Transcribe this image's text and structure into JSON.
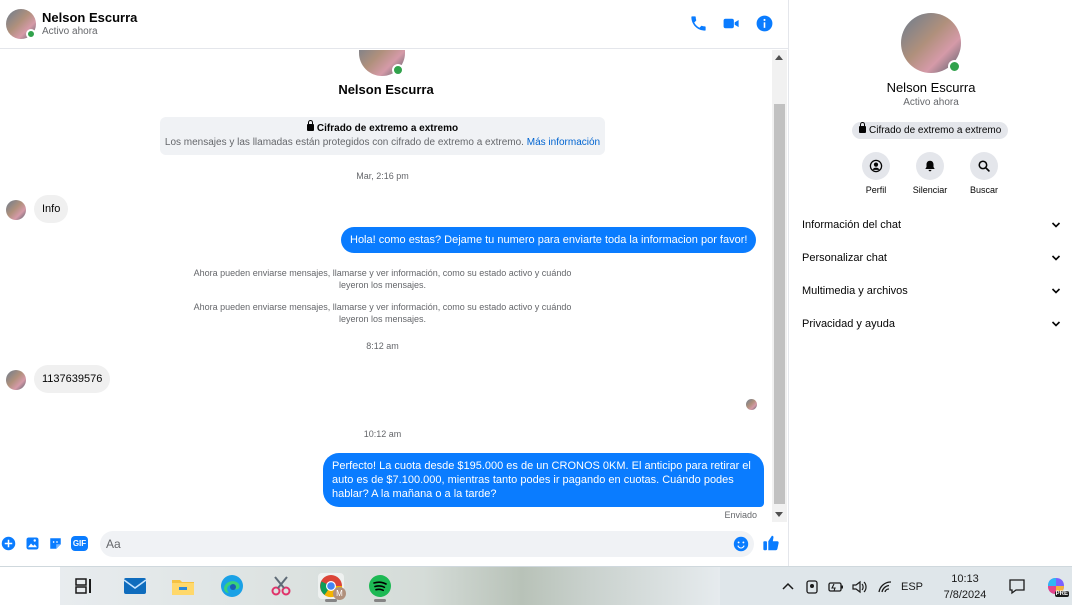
{
  "header": {
    "name": "Nelson Escurra",
    "status": "Activo ahora",
    "icons": [
      "phone-icon",
      "video-camera-icon",
      "info-icon"
    ],
    "accent_color": "#0a7cff"
  },
  "thread": {
    "contact_name": "Nelson Escurra",
    "e2e_title": "Cifrado de extremo a extremo",
    "e2e_sub": "Los mensajes y las llamadas están protegidos con cifrado de extremo a extremo.",
    "e2e_link": "Más información",
    "timestamps": [
      "Mar, 2:16 pm",
      "8:12 am",
      "10:12 am"
    ],
    "system_messages": [
      "Ahora pueden enviarse mensajes, llamarse y ver información, como su estado activo y cuándo leyeron los mensajes.",
      "Ahora pueden enviarse mensajes, llamarse y ver información, como su estado activo y cuándo leyeron los mensajes."
    ],
    "messages": [
      {
        "from": "contact",
        "text": "Info"
      },
      {
        "from": "me",
        "text": "Hola! como estas? Dejame tu numero para enviarte toda la informacion por favor!"
      },
      {
        "from": "contact",
        "text": "1137639576"
      },
      {
        "from": "me",
        "text": "Perfecto! La cuota desde $195.000 es de un CRONOS 0KM. El anticipo para retirar el auto es de $7.100.000, mientras tanto podes ir pagando en cuotas. Cuándo podes hablar? A la mañana o a la tarde?"
      }
    ],
    "sent_status": "Enviado"
  },
  "composer": {
    "placeholder": "Aa",
    "icons": [
      "plus-icon",
      "image-icon",
      "sticker-icon",
      "gif-icon",
      "emoji-icon",
      "thumbs-up-icon"
    ],
    "gif_label": "GIF"
  },
  "side_panel": {
    "name": "Nelson Escurra",
    "status": "Activo ahora",
    "e2e_badge": "Cifrado de extremo a extremo",
    "actions": [
      {
        "label": "Perfil",
        "icon": "profile-icon"
      },
      {
        "label": "Silenciar",
        "icon": "bell-icon"
      },
      {
        "label": "Buscar",
        "icon": "search-icon"
      }
    ],
    "menu": [
      {
        "label": "Información del chat"
      },
      {
        "label": "Personalizar chat"
      },
      {
        "label": "Multimedia y archivos"
      },
      {
        "label": "Privacidad y ayuda"
      }
    ]
  },
  "taskbar": {
    "apps": [
      "task-view-icon",
      "mail-icon",
      "file-explorer-icon",
      "edge-icon",
      "snipping-tool-icon",
      "chrome-icon",
      "spotify-icon"
    ],
    "language": "ESP",
    "time": "10:13",
    "date": "7/8/2024",
    "chrome_badge": "M",
    "copilot_badge": "PRE"
  }
}
